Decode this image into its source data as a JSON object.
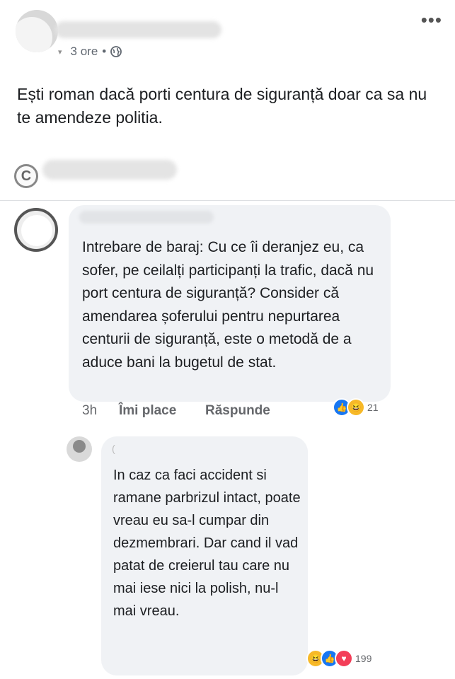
{
  "post": {
    "time": "3 ore",
    "separator": "•",
    "more_icon": "more-horizontal-icon",
    "privacy_icon": "globe-icon",
    "text": "Ești roman dacă porti centura de siguranță doar ca sa nu te amendeze politia.",
    "share_icon": "copyright-icon",
    "share_glyph": "C"
  },
  "comments": [
    {
      "text": "Intrebare de baraj: Cu ce îi deranjez eu, ca sofer, pe ceilalți participanți la trafic, dacă nu port centura de siguranță? Consider că amendarea șoferului pentru nepurtarea centurii de siguranță, este o metodă de a aduce bani la bugetul de stat.",
      "time": "3h",
      "like_label": "Îmi place",
      "reply_label": "Răspunde",
      "reactions": [
        "like",
        "haha"
      ],
      "reaction_count": "21"
    },
    {
      "name_fragment": "(",
      "text": "In caz ca faci accident si ramane parbrizul intact, poate vreau eu sa-l cumpar din dezmembrari. Dar cand il vad patat de creierul tau care nu mai iese nici la polish, nu-l mai vreau.",
      "reactions": [
        "haha",
        "like",
        "love"
      ],
      "reaction_count": "199"
    }
  ],
  "colors": {
    "like": "#1877f2",
    "haha": "#f7b928",
    "love": "#f33e58",
    "bubble": "#f0f2f5",
    "muted": "#65676b"
  }
}
